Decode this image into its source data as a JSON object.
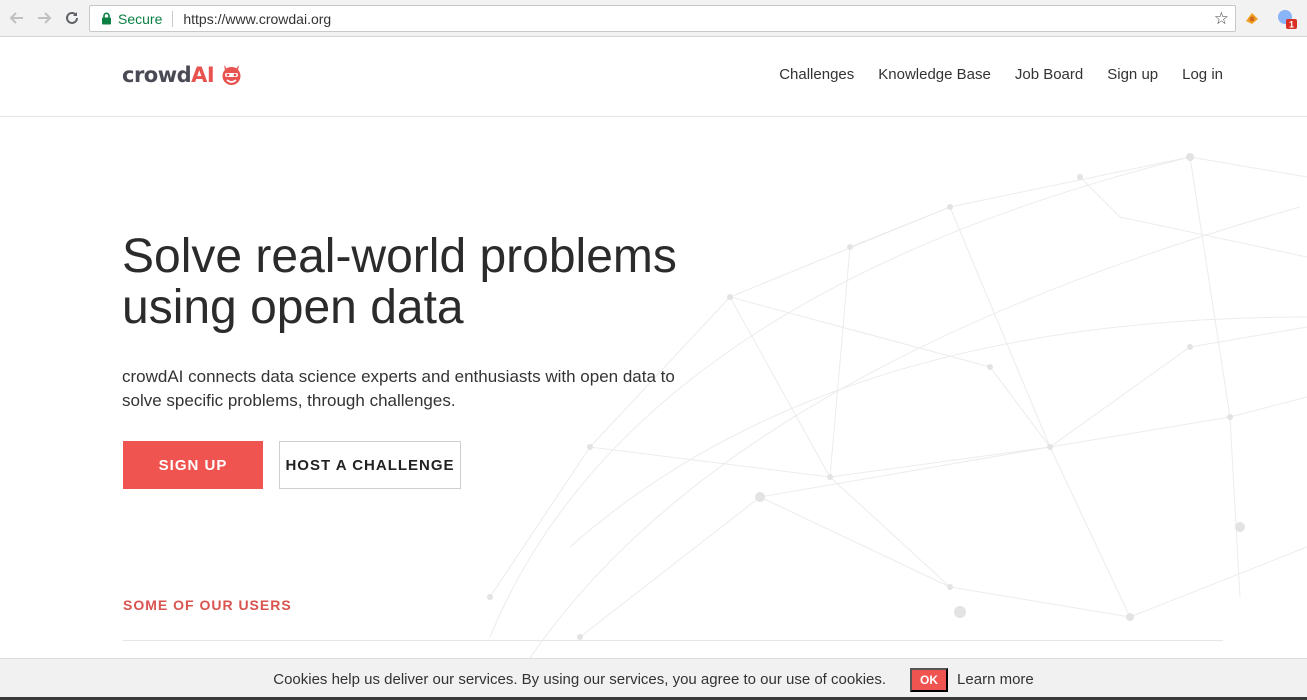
{
  "browser": {
    "secure_label": "Secure",
    "url": "https://www.crowdai.org",
    "extension_badge": "1"
  },
  "header": {
    "logo_crowd": "crowd",
    "logo_ai": "AI",
    "nav": [
      {
        "label": "Challenges"
      },
      {
        "label": "Knowledge Base"
      },
      {
        "label": "Job Board"
      },
      {
        "label": "Sign up"
      },
      {
        "label": "Log in"
      }
    ]
  },
  "hero": {
    "title_line1": "Solve real-world problems",
    "title_line2": "using open data",
    "subtitle_line1": "crowdAI connects data science experts and enthusiasts with open data to",
    "subtitle_line2": "solve specific problems, through challenges.",
    "signup_label": "SIGN UP",
    "host_label": "HOST A CHALLENGE"
  },
  "users": {
    "heading": "SOME OF OUR USERS"
  },
  "cookie": {
    "text": "Cookies help us deliver our services. By using our services, you agree to our use of cookies.",
    "ok_label": "OK",
    "learn_more_label": "Learn more"
  },
  "colors": {
    "accent": "#ef5450",
    "heading_red": "#d9534f",
    "secure_green": "#0b8043"
  }
}
